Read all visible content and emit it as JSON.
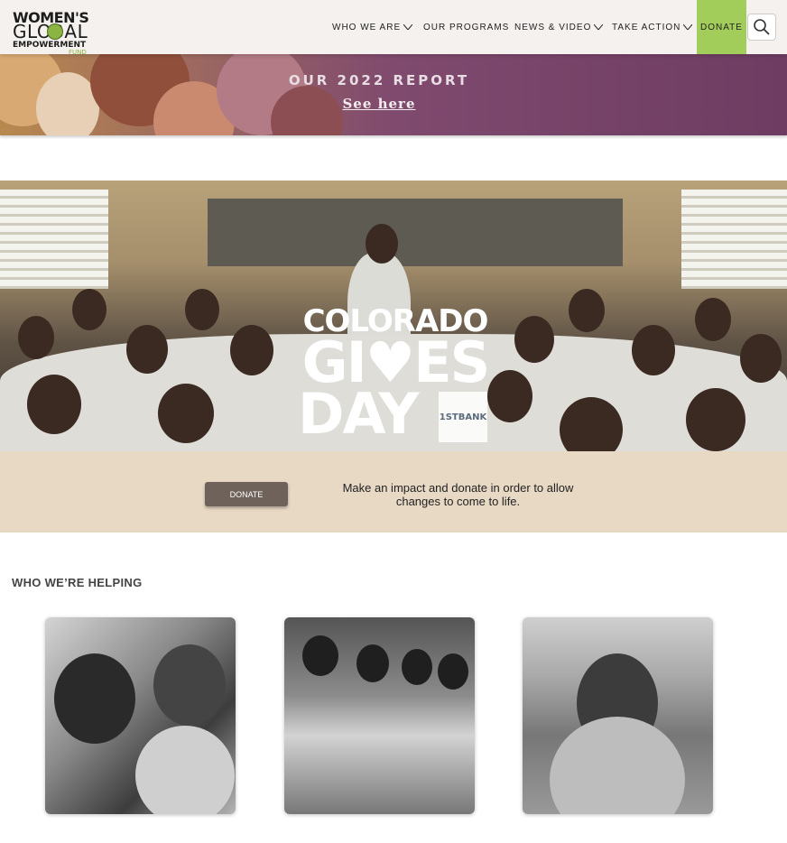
{
  "header": {
    "logo": {
      "line1": "WOMEN'S",
      "line2": "GLOBAL",
      "line3": "EMPOWERMENT",
      "line4": "FUND"
    },
    "nav": [
      {
        "label": "WHO WE ARE",
        "has_dropdown": true
      },
      {
        "label": "OUR PROGRAMS",
        "has_dropdown": false
      },
      {
        "label": "NEWS & VIDEO",
        "has_dropdown": true
      },
      {
        "label": "TAKE ACTION",
        "has_dropdown": true
      }
    ],
    "donate_label": "DONATE",
    "search_icon": "search-icon",
    "accent_color": "#a2cd5a"
  },
  "banner": {
    "title": "OUR 2022 REPORT",
    "link": "See here"
  },
  "hero": {
    "line1": "COLORADO",
    "line2": "GI♥ES",
    "line3": "DAY",
    "sponsor": "1STBANK"
  },
  "donate_band": {
    "button_label": "DONATE",
    "text": "Make an impact and donate in order to allow changes to come to life."
  },
  "helping": {
    "title": "WHO WE’RE HELPING"
  }
}
